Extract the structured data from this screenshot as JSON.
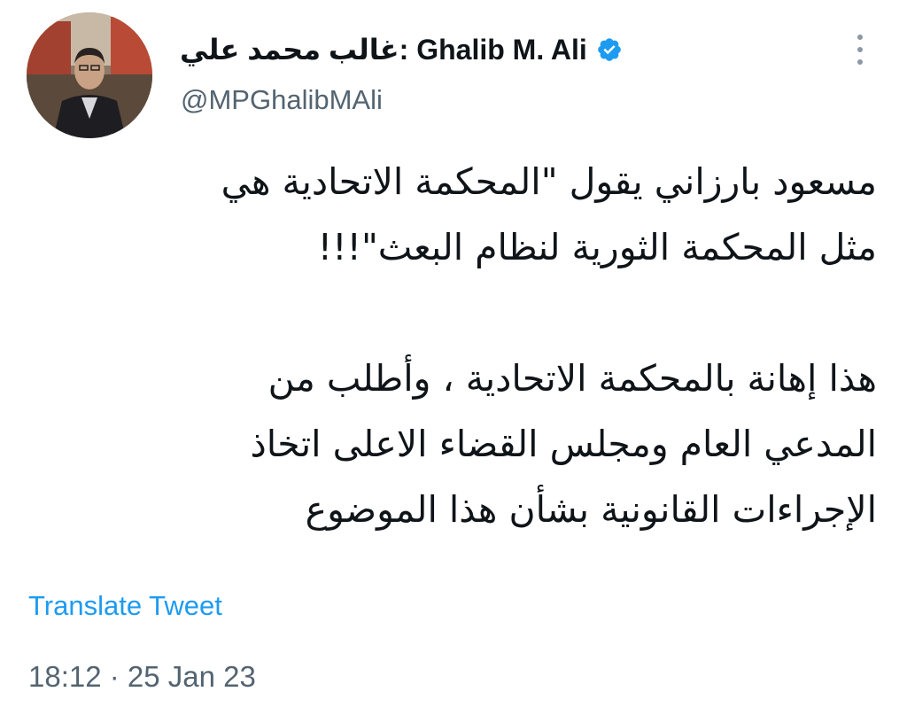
{
  "author": {
    "display_name": "غالب محمد علي: Ghalib M. Ali",
    "handle": "@MPGhalibMAli",
    "verified": true
  },
  "tweet": {
    "lines_para1": [
      "مسعود بارزاني يقول \"المحكمة الاتحادية هي",
      "مثل المحكمة الثورية لنظام البعث\"!!!"
    ],
    "lines_para2": [
      "هذا إهانة بالمحكمة الاتحادية ، وأطلب من",
      "المدعي العام ومجلس القضاء الاعلى اتخاذ",
      "الإجراءات القانونية بشأن هذا الموضوع"
    ]
  },
  "translate_label": "Translate Tweet",
  "timestamp": "18:12 · 25 Jan 23",
  "icons": {
    "verified": "verified-badge-icon",
    "more": "more-vertical-icon"
  },
  "colors": {
    "verified": "#1d9bf0",
    "link": "#1d9bf0",
    "secondary_text": "#536471",
    "primary_text": "#0f1419"
  }
}
